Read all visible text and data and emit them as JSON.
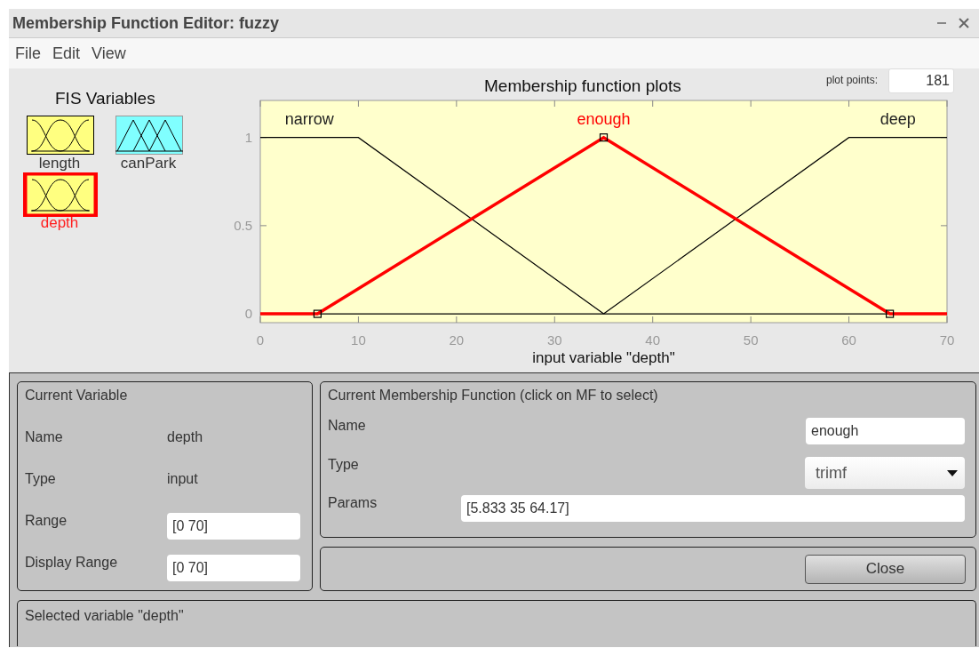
{
  "window": {
    "title": "Membership Function Editor: fuzzy"
  },
  "menu": [
    "File",
    "Edit",
    "View"
  ],
  "fis_variables": {
    "title": "FIS Variables",
    "items": [
      {
        "name": "length",
        "kind": "input",
        "color": "#ffff80",
        "selected": false
      },
      {
        "name": "canPark",
        "kind": "output",
        "color": "#80ffff",
        "selected": false
      },
      {
        "name": "depth",
        "kind": "input",
        "color": "#ffff80",
        "selected": true
      }
    ]
  },
  "plot": {
    "plot_points_label": "plot points:",
    "plot_points": "181",
    "chart_data": {
      "type": "line",
      "title": "Membership function plots",
      "xlabel": "input variable \"depth\"",
      "x": [
        0,
        5.833,
        10,
        35,
        60,
        64.17,
        70
      ],
      "series": [
        {
          "name": "narrow",
          "values": [
            1,
            1,
            1,
            0,
            null,
            null,
            null
          ]
        },
        {
          "name": "enough",
          "values": [
            0,
            0,
            0.143,
            1,
            0.143,
            0,
            0
          ]
        },
        {
          "name": "deep",
          "values": [
            null,
            null,
            null,
            0,
            1,
            1,
            1
          ]
        }
      ],
      "xlim": [
        0,
        70
      ],
      "ylim": [
        -0.05,
        1.21
      ],
      "xticks": [
        0,
        10,
        20,
        30,
        40,
        50,
        60,
        70
      ],
      "yticks": [
        0,
        0.5,
        1
      ]
    },
    "mf_states": [
      {
        "selected": false
      },
      {
        "selected": true
      },
      {
        "selected": false
      }
    ]
  },
  "current_variable": {
    "title": "Current Variable",
    "name_label": "Name",
    "name": "depth",
    "type_label": "Type",
    "type": "input",
    "range_label": "Range",
    "range": "[0 70]",
    "display_range_label": "Display Range",
    "display_range": "[0 70]"
  },
  "current_mf": {
    "title": "Current Membership Function (click on MF to select)",
    "name_label": "Name",
    "name": "enough",
    "type_label": "Type",
    "type": "trimf",
    "params_label": "Params",
    "params": "[5.833 35 64.17]"
  },
  "close_button": "Close",
  "status": "Selected variable \"depth\""
}
